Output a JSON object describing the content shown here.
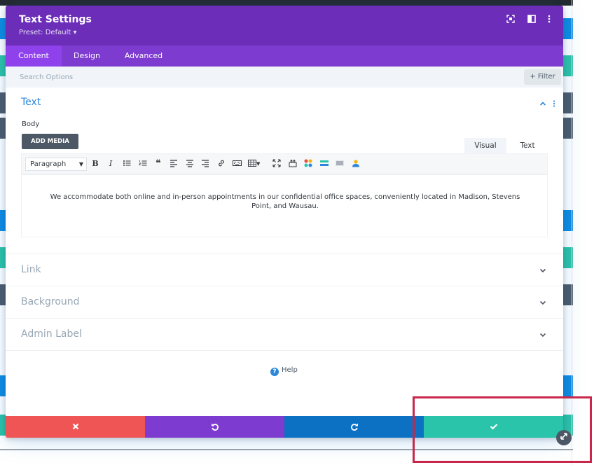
{
  "modal": {
    "title": "Text Settings",
    "preset": "Preset: Default ▾",
    "header_icons": [
      "focus-icon",
      "split-view-icon",
      "more-vertical-icon"
    ]
  },
  "tabs": [
    {
      "label": "Content",
      "active": true
    },
    {
      "label": "Design",
      "active": false
    },
    {
      "label": "Advanced",
      "active": false
    }
  ],
  "search": {
    "placeholder": "Search Options",
    "filter_label": "+ Filter"
  },
  "text_section": {
    "title": "Text",
    "body_label": "Body",
    "add_media_label": "ADD MEDIA",
    "mode_tabs": {
      "visual": "Visual",
      "text": "Text"
    },
    "toolbar": {
      "paragraph_select": "Paragraph",
      "icons": [
        "bold-icon",
        "italic-icon",
        "bullet-list-icon",
        "numbered-list-icon",
        "blockquote-icon",
        "align-left-icon",
        "align-center-icon",
        "align-right-icon",
        "link-icon",
        "keyboard-icon",
        "table-icon",
        "fullscreen-icon",
        "paste-icon",
        "color-swatch-icon",
        "horizontal-rule-icon",
        "text-lines-icon",
        "user-icon"
      ]
    },
    "content": "We accommodate both online and in-person appointments in our confidential office spaces, conveniently located in Madison, Stevens Point, and Wausau."
  },
  "accordions": [
    {
      "title": "Link"
    },
    {
      "title": "Background"
    },
    {
      "title": "Admin Label"
    }
  ],
  "help_label": "Help",
  "footer": {
    "cancel_color": "#ef5555",
    "undo_color": "#7e3bd0",
    "redo_color": "#0c71c3",
    "save_color": "#29c4a9"
  },
  "colors": {
    "header": "#6c2eb9",
    "tabs": "#7d3bcf",
    "accent": "#2b87da",
    "highlight": "#c8274b"
  }
}
